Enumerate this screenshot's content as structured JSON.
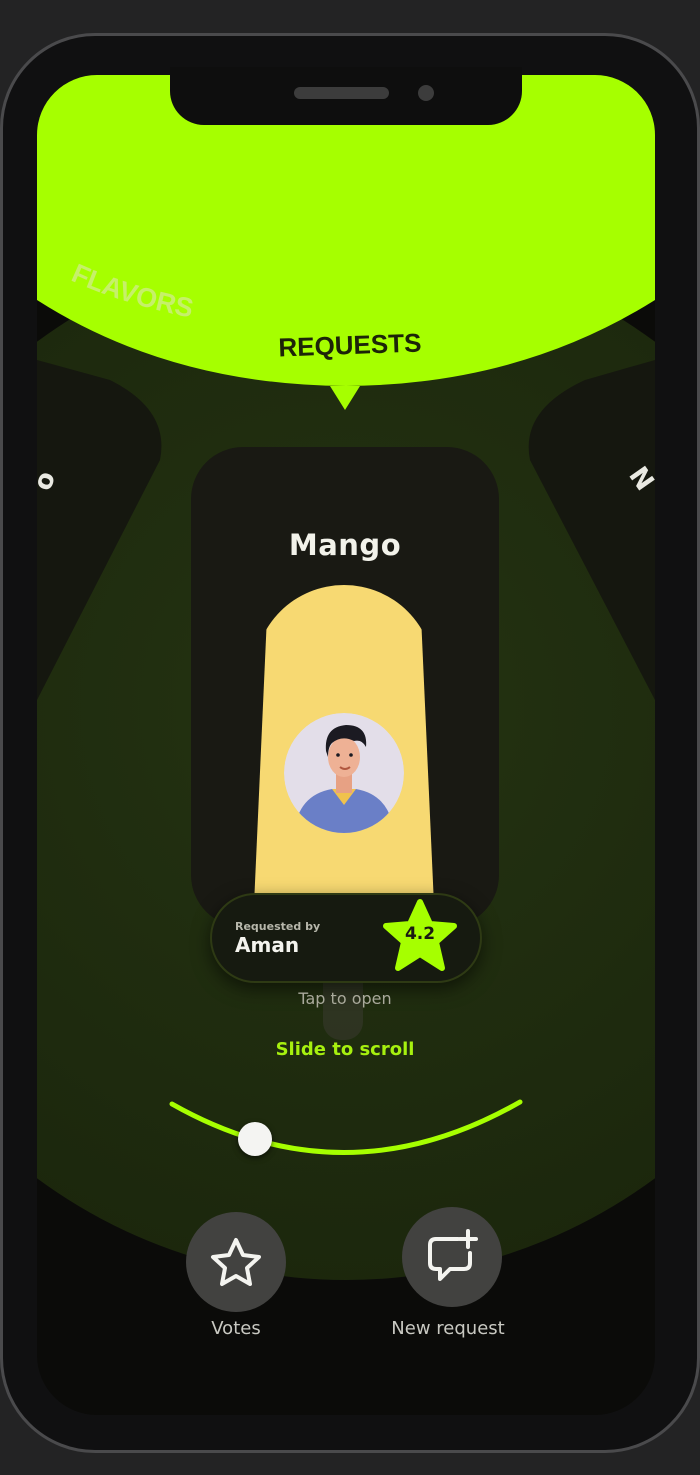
{
  "tabs": {
    "inactive_label": "FLAVORS",
    "active_label": "REQUESTS"
  },
  "card": {
    "title": "Mango",
    "requested_by_label": "Requested by",
    "requested_by_name": "Aman",
    "rating": "4.2"
  },
  "hints": {
    "tap": "Tap to open",
    "slide": "Slide to scroll"
  },
  "side_cards": {
    "left_glyph": "o",
    "right_glyph": "N"
  },
  "slider": {
    "position_fraction": 0.2
  },
  "bottom_nav": {
    "votes_label": "Votes",
    "new_request_label": "New request"
  },
  "colors": {
    "accent": "#a6ff00",
    "popsicle": "#f7d972",
    "background": "#0a0a08"
  },
  "icons": {
    "votes": "star-icon",
    "new_request": "chat-plus-icon",
    "rating": "star-badge-icon"
  }
}
